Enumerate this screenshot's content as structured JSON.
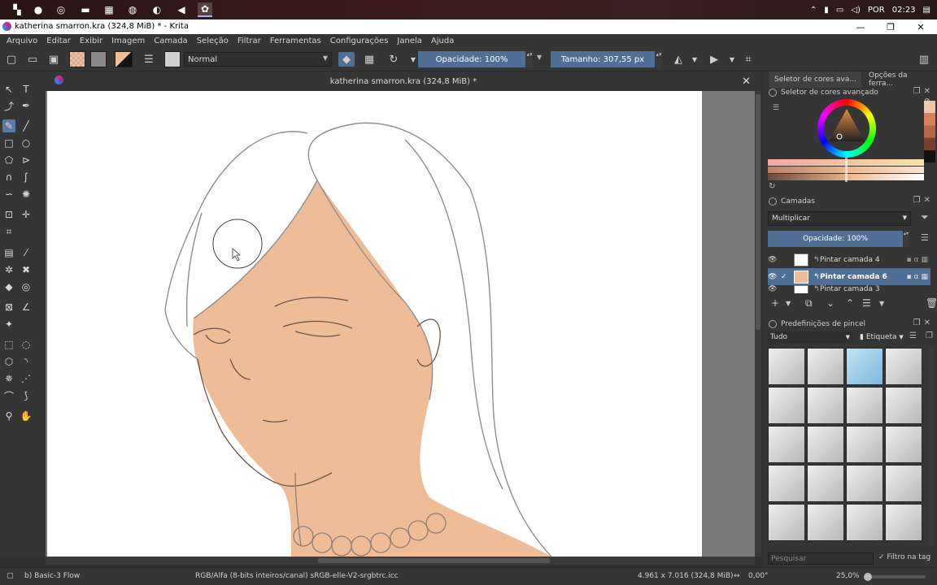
{
  "taskbar": {
    "tray_language": "POR",
    "tray_time": "02:23"
  },
  "window": {
    "title": "katherina smarron.kra (324,8 MiB) * - Krita"
  },
  "menu": [
    "Arquivo",
    "Editar",
    "Exibir",
    "Imagem",
    "Camada",
    "Seleção",
    "Filtrar",
    "Ferramentas",
    "Configurações",
    "Janela",
    "Ajuda"
  ],
  "toolbar": {
    "blend_mode": "Normal",
    "opacity_label": "Opacidade: 100%",
    "size_label": "Tamanho: 307,55 px"
  },
  "document": {
    "tab_title": "katherina smarron.kra (324,8 MiB) *"
  },
  "dock": {
    "tab_color": "Seletor de cores ava...",
    "tab_tool": "Opções da ferra...",
    "color_panel_title": "Seletor de cores avançado",
    "layers_panel_title": "Camadas",
    "layers_blend_mode": "Multiplicar",
    "layers_opacity": "Opacidade:  100%",
    "layers": [
      {
        "name": "Pintar camada 4",
        "selected": false
      },
      {
        "name": "Pintar camada 6",
        "selected": true
      },
      {
        "name": "Pintar camada 3",
        "selected": false
      }
    ],
    "brush_panel_title": "Predefinições de pincel",
    "brush_filter": "Tudo",
    "brush_tag": "Etiqueta",
    "search_placeholder": "Pesquisar",
    "filter_tag_label": "Filtro na tag"
  },
  "status": {
    "brush_name": "b) Basic-3 Flow",
    "color_space": "RGB/Alfa (8-bits inteiros/canal)  sRGB-elle-V2-srgbtrc.icc",
    "dimensions": "4.961 x 7.016 (324,8 MiB)",
    "rotation": "0,00°",
    "zoom": "25,0%"
  },
  "colors": {
    "accent": "#4f6f95",
    "skin": "#eebd98",
    "panel_bg": "#353535"
  }
}
